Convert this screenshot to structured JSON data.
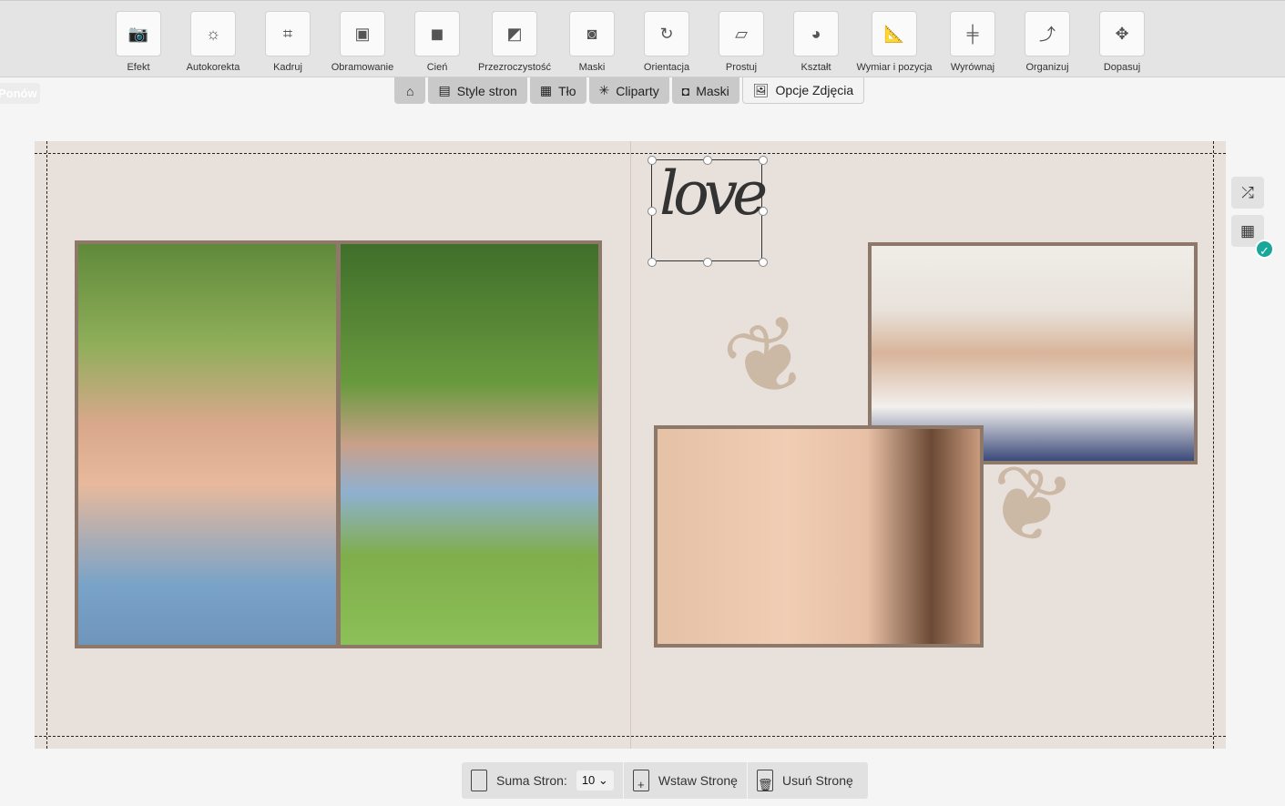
{
  "toolbar": {
    "tools": [
      {
        "label": "Efekt",
        "icon": "camera-star-icon",
        "glyph": "📷"
      },
      {
        "label": "Autokorekta",
        "icon": "brightness-icon",
        "glyph": "☼"
      },
      {
        "label": "Kadruj",
        "icon": "crop-icon",
        "glyph": "⌗"
      },
      {
        "label": "Obramowanie",
        "icon": "border-frame-icon",
        "glyph": "▣"
      },
      {
        "label": "Cień",
        "icon": "shadow-icon",
        "glyph": "◼"
      },
      {
        "label": "Przezroczystość",
        "icon": "transparency-icon",
        "glyph": "◩"
      },
      {
        "label": "Maski",
        "icon": "mask-icon",
        "glyph": "◙"
      },
      {
        "label": "Orientacja",
        "icon": "rotate-icon",
        "glyph": "↻"
      },
      {
        "label": "Prostuj",
        "icon": "straighten-icon",
        "glyph": "▱"
      },
      {
        "label": "Kształt",
        "icon": "shape-icon",
        "glyph": "◕"
      },
      {
        "label": "Wymiar i pozycja",
        "icon": "ruler-icon",
        "glyph": "📐"
      },
      {
        "label": "Wyrównaj",
        "icon": "align-icon",
        "glyph": "╪"
      },
      {
        "label": "Organizuj",
        "icon": "arrange-icon",
        "glyph": "⤴"
      },
      {
        "label": "Dopasuj",
        "icon": "move-icon",
        "glyph": "✥"
      }
    ]
  },
  "redo_label": "Ponów",
  "tabs": [
    {
      "label": "",
      "icon": "home-icon",
      "glyph": "⌂"
    },
    {
      "label": "Style stron",
      "icon": "page-style-icon",
      "glyph": "▤"
    },
    {
      "label": "Tło",
      "icon": "background-icon",
      "glyph": "▦"
    },
    {
      "label": "Cliparty",
      "icon": "clipart-icon",
      "glyph": "✳"
    },
    {
      "label": "Maski",
      "icon": "mask-icon",
      "glyph": "◘"
    },
    {
      "label": "Opcje Zdjęcia",
      "icon": "photo-options-icon",
      "glyph": "🖼"
    }
  ],
  "clipart_text": "love",
  "side": {
    "shuffle_glyph": "⤮",
    "layout_glyph": "▦",
    "check_glyph": "✓"
  },
  "bottom": {
    "total_label": "Suma Stron:",
    "total_value": "10",
    "insert_label": "Wstaw Stronę",
    "delete_label": "Usuń Stronę"
  }
}
